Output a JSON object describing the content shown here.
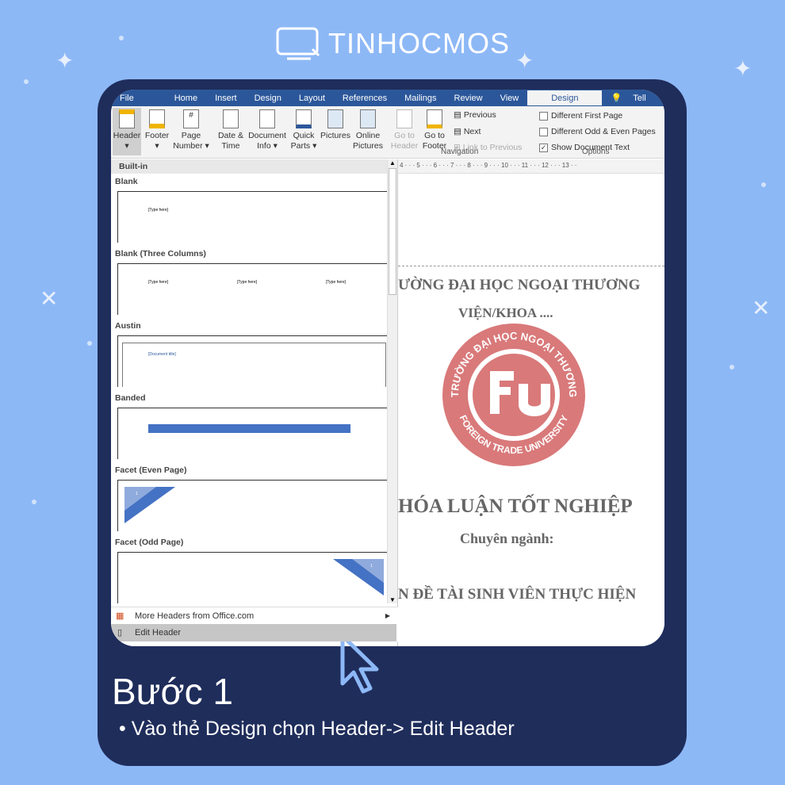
{
  "brand": "TINHOCMOS",
  "ribbon": {
    "tabs": [
      "File",
      "Home",
      "Insert",
      "Design",
      "Layout",
      "References",
      "Mailings",
      "Review",
      "View"
    ],
    "active_tab": "Design",
    "tell_me": "Tell",
    "buttons": [
      {
        "l1": "Header",
        "l2": "▾"
      },
      {
        "l1": "Footer",
        "l2": "▾"
      },
      {
        "l1": "Page",
        "l2": "Number ▾"
      },
      {
        "l1": "Date &",
        "l2": "Time"
      },
      {
        "l1": "Document",
        "l2": "Info ▾"
      },
      {
        "l1": "Quick",
        "l2": "Parts ▾"
      },
      {
        "l1": "Pictures",
        "l2": ""
      },
      {
        "l1": "Online",
        "l2": "Pictures"
      },
      {
        "l1": "Go to",
        "l2": "Header"
      },
      {
        "l1": "Go to",
        "l2": "Footer"
      }
    ],
    "nav": {
      "previous": "Previous",
      "next": "Next",
      "link": "Link to Previous",
      "group": "Navigation"
    },
    "options": {
      "group": "Options",
      "items": [
        {
          "label": "Different First Page",
          "checked": false
        },
        {
          "label": "Different Odd & Even Pages",
          "checked": false
        },
        {
          "label": "Show Document Text",
          "checked": true
        }
      ]
    }
  },
  "gallery": {
    "heading": "Built-in",
    "items": [
      "Blank",
      "Blank (Three Columns)",
      "Austin",
      "Banded",
      "Facet (Even Page)",
      "Facet (Odd Page)"
    ],
    "placeholder": "[Type here]",
    "doc_title": "[Document title]",
    "page_num": "1",
    "more": "More Headers from Office.com",
    "edit": "Edit Header"
  },
  "ruler": "4 · · · 5 · · · 6 · · · 7 · · · 8 · · · 9 · · · 10 · · · 11 · · · 12 · · · 13 · ·",
  "document": {
    "l1": "ƯỜNG ĐẠI HỌC NGOẠI THƯƠNG",
    "l2": "VIỆN/KHOA ....",
    "seal_top": "TRƯỜNG ĐẠI HỌC NGOẠI THƯƠNG",
    "seal_bottom": "FOREIGN TRADE UNIVERSITY",
    "l3": "HÓA LUẬN TỐT NGHIỆP",
    "l4": "Chuyên ngành:",
    "l5": "N ĐỀ TÀI SINH VIÊN THỰC HIỆN"
  },
  "step": {
    "title": "Bước 1",
    "bullet": "Vào thẻ Design chọn Header-> Edit Header"
  },
  "colors": {
    "background": "#8db8f6",
    "card": "#1f2d5b",
    "word_blue": "#2b579a",
    "seal": "#d9797a"
  }
}
